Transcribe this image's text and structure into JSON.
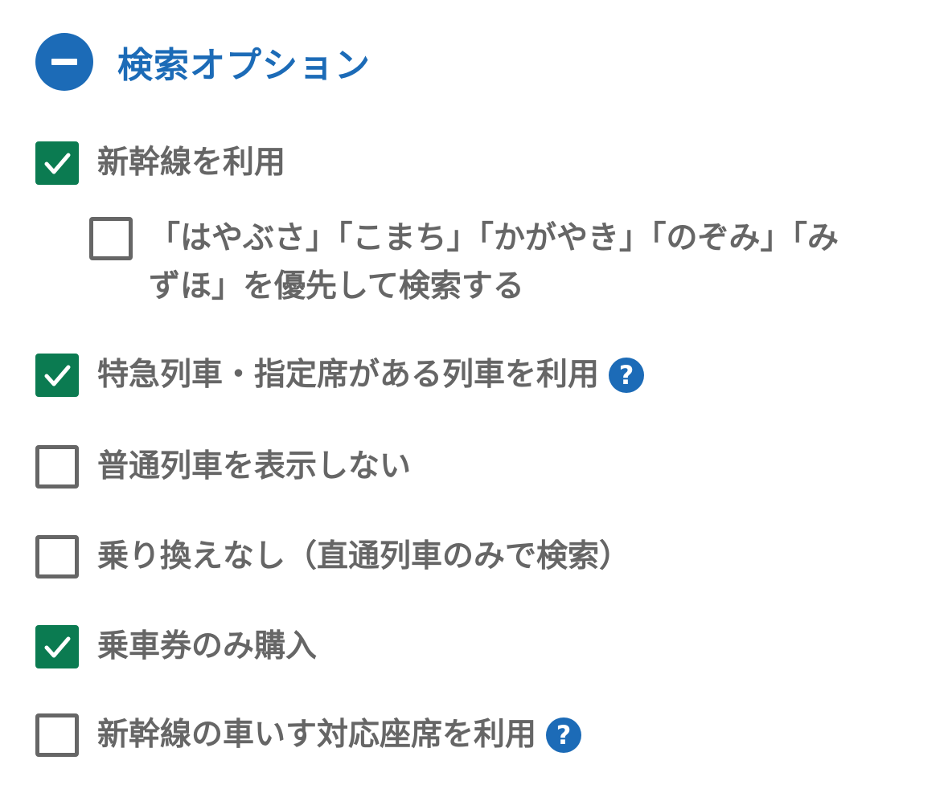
{
  "header": {
    "title": "検索オプション",
    "collapse_icon": "minus-circle-icon"
  },
  "options": [
    {
      "label": "新幹線を利用",
      "checked": true
    },
    {
      "label": "「はやぶさ」「こまち」「かがやき」「のぞみ」「みずほ」を優先して検索する",
      "checked": false
    },
    {
      "label": "特急列車・指定席がある列車を利用",
      "checked": true,
      "help": "?"
    },
    {
      "label": "普通列車を表示しない",
      "checked": false
    },
    {
      "label": "乗り換えなし（直通列車のみで検索）",
      "checked": false
    },
    {
      "label": "乗車券のみ購入",
      "checked": true
    },
    {
      "label": "新幹線の車いす対応座席を利用",
      "checked": false,
      "help": "?"
    }
  ],
  "colors": {
    "accent": "#1c6bb7",
    "checked": "#0b7b51",
    "text": "#666666"
  }
}
